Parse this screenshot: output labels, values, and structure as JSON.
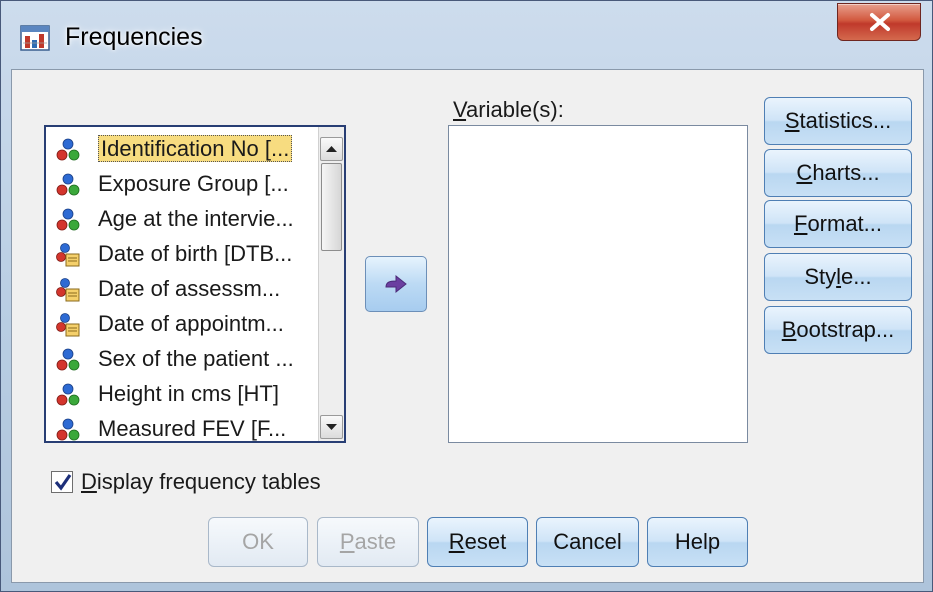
{
  "window": {
    "title": "Frequencies",
    "close_glyph": "X"
  },
  "source_list": {
    "items": [
      {
        "label": "Identification No [...",
        "icon": "nominal-variable-icon",
        "selected": true
      },
      {
        "label": "Exposure Group [...",
        "icon": "nominal-variable-icon",
        "selected": false
      },
      {
        "label": "Age at the intervie...",
        "icon": "nominal-variable-icon",
        "selected": false
      },
      {
        "label": "Date of birth [DTB...",
        "icon": "date-variable-icon",
        "selected": false
      },
      {
        "label": "Date of assessm...",
        "icon": "date-variable-icon",
        "selected": false
      },
      {
        "label": "Date of appointm...",
        "icon": "date-variable-icon",
        "selected": false
      },
      {
        "label": "Sex of the patient ...",
        "icon": "nominal-variable-icon",
        "selected": false
      },
      {
        "label": "Height in cms [HT]",
        "icon": "nominal-variable-icon",
        "selected": false
      },
      {
        "label": "Measured FEV [F...",
        "icon": "nominal-variable-icon",
        "selected": false
      }
    ]
  },
  "target": {
    "label_mnemonic": "V",
    "label_rest": "ariable(s):"
  },
  "side_buttons": {
    "statistics": {
      "mnemonic": "S",
      "rest": "tatistics..."
    },
    "charts": {
      "mnemonic": "C",
      "rest": "harts..."
    },
    "format": {
      "mnemonic": "F",
      "rest": "ormat..."
    },
    "style": {
      "pre": "Sty",
      "mnemonic": "l",
      "rest": "e..."
    },
    "bootstrap": {
      "mnemonic": "B",
      "rest": "ootstrap..."
    }
  },
  "checkbox": {
    "checked": true,
    "label_mnemonic": "D",
    "label_rest": "isplay frequency tables"
  },
  "bottom_buttons": {
    "ok": "OK",
    "paste": {
      "mnemonic": "P",
      "rest": "aste"
    },
    "reset": {
      "mnemonic": "R",
      "rest": "eset"
    },
    "cancel": "Cancel",
    "help": "Help"
  },
  "colors": {
    "selection": "#f7dc80",
    "button_border": "#4f7fb4",
    "close_button": "#c0392b"
  }
}
